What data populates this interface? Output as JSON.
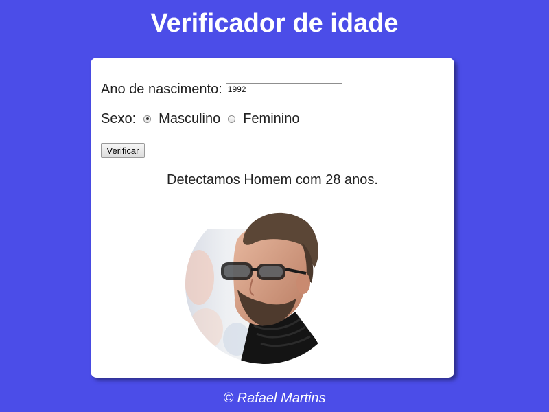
{
  "header": {
    "title": "Verificador de idade"
  },
  "form": {
    "year_label": "Ano de nascimento:",
    "year_value": "1992",
    "sex_label": "Sexo:",
    "sex_options": [
      {
        "label": "Masculino",
        "checked": true
      },
      {
        "label": "Feminino",
        "checked": false
      }
    ],
    "submit_label": "Verificar"
  },
  "result": {
    "text": "Detectamos Homem com 28 anos.",
    "image_icon": "man-portrait-photo"
  },
  "footer": {
    "credit": "© Rafael Martins"
  },
  "colors": {
    "background": "#4b4de8",
    "card": "#ffffff",
    "text": "#222222"
  }
}
